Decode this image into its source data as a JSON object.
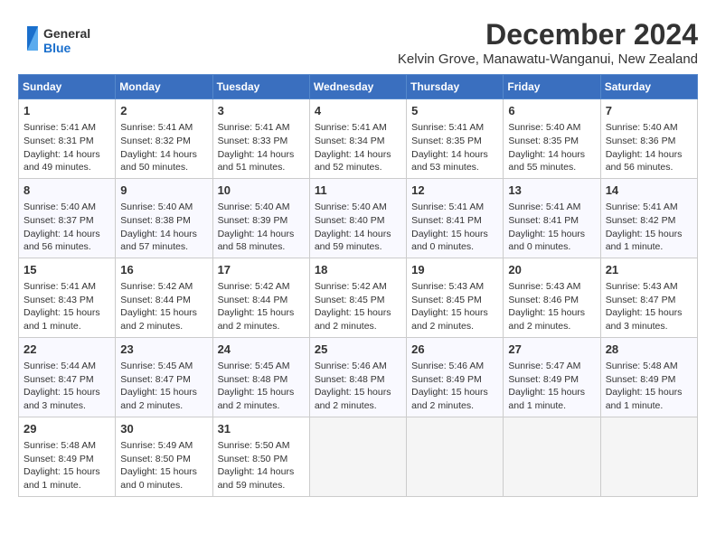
{
  "logo": {
    "line1": "General",
    "line2": "Blue"
  },
  "title": "December 2024",
  "subtitle": "Kelvin Grove, Manawatu-Wanganui, New Zealand",
  "weekdays": [
    "Sunday",
    "Monday",
    "Tuesday",
    "Wednesday",
    "Thursday",
    "Friday",
    "Saturday"
  ],
  "weeks": [
    [
      {
        "day": 1,
        "info": "Sunrise: 5:41 AM\nSunset: 8:31 PM\nDaylight: 14 hours\nand 49 minutes."
      },
      {
        "day": 2,
        "info": "Sunrise: 5:41 AM\nSunset: 8:32 PM\nDaylight: 14 hours\nand 50 minutes."
      },
      {
        "day": 3,
        "info": "Sunrise: 5:41 AM\nSunset: 8:33 PM\nDaylight: 14 hours\nand 51 minutes."
      },
      {
        "day": 4,
        "info": "Sunrise: 5:41 AM\nSunset: 8:34 PM\nDaylight: 14 hours\nand 52 minutes."
      },
      {
        "day": 5,
        "info": "Sunrise: 5:41 AM\nSunset: 8:35 PM\nDaylight: 14 hours\nand 53 minutes."
      },
      {
        "day": 6,
        "info": "Sunrise: 5:40 AM\nSunset: 8:35 PM\nDaylight: 14 hours\nand 55 minutes."
      },
      {
        "day": 7,
        "info": "Sunrise: 5:40 AM\nSunset: 8:36 PM\nDaylight: 14 hours\nand 56 minutes."
      }
    ],
    [
      {
        "day": 8,
        "info": "Sunrise: 5:40 AM\nSunset: 8:37 PM\nDaylight: 14 hours\nand 56 minutes."
      },
      {
        "day": 9,
        "info": "Sunrise: 5:40 AM\nSunset: 8:38 PM\nDaylight: 14 hours\nand 57 minutes."
      },
      {
        "day": 10,
        "info": "Sunrise: 5:40 AM\nSunset: 8:39 PM\nDaylight: 14 hours\nand 58 minutes."
      },
      {
        "day": 11,
        "info": "Sunrise: 5:40 AM\nSunset: 8:40 PM\nDaylight: 14 hours\nand 59 minutes."
      },
      {
        "day": 12,
        "info": "Sunrise: 5:41 AM\nSunset: 8:41 PM\nDaylight: 15 hours\nand 0 minutes."
      },
      {
        "day": 13,
        "info": "Sunrise: 5:41 AM\nSunset: 8:41 PM\nDaylight: 15 hours\nand 0 minutes."
      },
      {
        "day": 14,
        "info": "Sunrise: 5:41 AM\nSunset: 8:42 PM\nDaylight: 15 hours\nand 1 minute."
      }
    ],
    [
      {
        "day": 15,
        "info": "Sunrise: 5:41 AM\nSunset: 8:43 PM\nDaylight: 15 hours\nand 1 minute."
      },
      {
        "day": 16,
        "info": "Sunrise: 5:42 AM\nSunset: 8:44 PM\nDaylight: 15 hours\nand 2 minutes."
      },
      {
        "day": 17,
        "info": "Sunrise: 5:42 AM\nSunset: 8:44 PM\nDaylight: 15 hours\nand 2 minutes."
      },
      {
        "day": 18,
        "info": "Sunrise: 5:42 AM\nSunset: 8:45 PM\nDaylight: 15 hours\nand 2 minutes."
      },
      {
        "day": 19,
        "info": "Sunrise: 5:43 AM\nSunset: 8:45 PM\nDaylight: 15 hours\nand 2 minutes."
      },
      {
        "day": 20,
        "info": "Sunrise: 5:43 AM\nSunset: 8:46 PM\nDaylight: 15 hours\nand 2 minutes."
      },
      {
        "day": 21,
        "info": "Sunrise: 5:43 AM\nSunset: 8:47 PM\nDaylight: 15 hours\nand 3 minutes."
      }
    ],
    [
      {
        "day": 22,
        "info": "Sunrise: 5:44 AM\nSunset: 8:47 PM\nDaylight: 15 hours\nand 3 minutes."
      },
      {
        "day": 23,
        "info": "Sunrise: 5:45 AM\nSunset: 8:47 PM\nDaylight: 15 hours\nand 2 minutes."
      },
      {
        "day": 24,
        "info": "Sunrise: 5:45 AM\nSunset: 8:48 PM\nDaylight: 15 hours\nand 2 minutes."
      },
      {
        "day": 25,
        "info": "Sunrise: 5:46 AM\nSunset: 8:48 PM\nDaylight: 15 hours\nand 2 minutes."
      },
      {
        "day": 26,
        "info": "Sunrise: 5:46 AM\nSunset: 8:49 PM\nDaylight: 15 hours\nand 2 minutes."
      },
      {
        "day": 27,
        "info": "Sunrise: 5:47 AM\nSunset: 8:49 PM\nDaylight: 15 hours\nand 1 minute."
      },
      {
        "day": 28,
        "info": "Sunrise: 5:48 AM\nSunset: 8:49 PM\nDaylight: 15 hours\nand 1 minute."
      }
    ],
    [
      {
        "day": 29,
        "info": "Sunrise: 5:48 AM\nSunset: 8:49 PM\nDaylight: 15 hours\nand 1 minute."
      },
      {
        "day": 30,
        "info": "Sunrise: 5:49 AM\nSunset: 8:50 PM\nDaylight: 15 hours\nand 0 minutes."
      },
      {
        "day": 31,
        "info": "Sunrise: 5:50 AM\nSunset: 8:50 PM\nDaylight: 14 hours\nand 59 minutes."
      },
      null,
      null,
      null,
      null
    ]
  ]
}
